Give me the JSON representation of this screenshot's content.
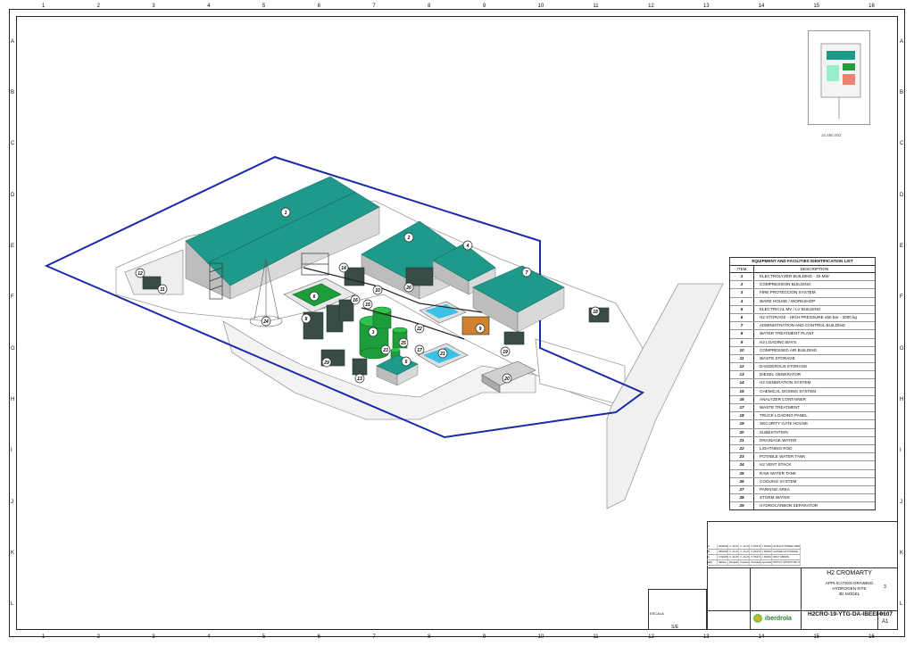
{
  "sheet": {
    "columns": [
      "1",
      "2",
      "3",
      "4",
      "5",
      "6",
      "7",
      "8",
      "9",
      "10",
      "11",
      "12",
      "13",
      "14",
      "15",
      "16"
    ],
    "rows": [
      "A",
      "B",
      "C",
      "D",
      "E",
      "F",
      "G",
      "H",
      "I",
      "J",
      "K",
      "L"
    ]
  },
  "key_plan": {
    "label": "15.480.002"
  },
  "equipment_list": {
    "title": "EQUIPMENT AND FACILITIES IDENTIFICATION LIST",
    "col_item": "ITEM",
    "col_desc": "DESCRIPTION",
    "items": [
      {
        "n": "1",
        "d": "ELECTROLYZER BUILDING - 15 MW"
      },
      {
        "n": "2",
        "d": "COMPRESSION BUILDING"
      },
      {
        "n": "3",
        "d": "FIRE PROTECCION SYSTEM"
      },
      {
        "n": "4",
        "d": "WARE HOUSE / WORKSHOP"
      },
      {
        "n": "5",
        "d": "ELECTRICAL MV / LV BUILDING"
      },
      {
        "n": "6",
        "d": "H2 STORAGE - HIGH PRESSURE 450 bar - 2000 kg"
      },
      {
        "n": "7",
        "d": "ADMINISTRATION AND CONTROL BUILDING"
      },
      {
        "n": "8",
        "d": "WATER TREATMENT PLANT"
      },
      {
        "n": "9",
        "d": "H2 LOADING BAYS"
      },
      {
        "n": "10",
        "d": "COMPRESSED AIR BUILDING"
      },
      {
        "n": "11",
        "d": "WASTE STORAGE"
      },
      {
        "n": "12",
        "d": "DANGEROUS STORAGE"
      },
      {
        "n": "13",
        "d": "DIESEL GENERATOR"
      },
      {
        "n": "14",
        "d": "H2 GENERATION SYSTEM"
      },
      {
        "n": "15",
        "d": "CHEMICAL DOSING SYSTEM"
      },
      {
        "n": "16",
        "d": "ANALYZER CONTAINER"
      },
      {
        "n": "17",
        "d": "WASTE TREATMENT"
      },
      {
        "n": "18",
        "d": "TRUCK LOADING PANEL"
      },
      {
        "n": "19",
        "d": "SECURITY GATE HOUSE"
      },
      {
        "n": "20",
        "d": "SUBESTATION"
      },
      {
        "n": "21",
        "d": "DRAINAGE WATER"
      },
      {
        "n": "22",
        "d": "LIGHTNING ROD"
      },
      {
        "n": "23",
        "d": "POTABLE WATER TANK"
      },
      {
        "n": "24",
        "d": "H2 VENT STACK"
      },
      {
        "n": "25",
        "d": "RAW WATER TANK"
      },
      {
        "n": "26",
        "d": "COOLING SYSTEM"
      },
      {
        "n": "27",
        "d": "PARKING AREA"
      },
      {
        "n": "28",
        "d": "STORM WATER"
      },
      {
        "n": "29",
        "d": "HYDROCARBON SEPARATOR"
      }
    ]
  },
  "site_labels": [
    "1",
    "2",
    "4",
    "7",
    "8",
    "9",
    "12",
    "11",
    "14",
    "15",
    "16",
    "6",
    "3",
    "25",
    "23",
    "5",
    "17",
    "21",
    "22",
    "20",
    "26",
    "13",
    "10",
    "19",
    "24",
    "29",
    "18"
  ],
  "title_block": {
    "project": "H2 CROMARTY",
    "lines": [
      "APPLICATION DRAWING",
      "HYDROGEN SITE",
      "3D MODEL"
    ],
    "doc_number": "H2CRO-19-YTG-DA-IBEEI-0107",
    "scale_label": "ESCALA",
    "scale": "S/E",
    "company": "iberdrola",
    "rev_label": "Rev",
    "rev": "A1",
    "sheet_no": "3"
  },
  "revisions": [
    [
      "C",
      "29/06/2022",
      "C. ALONSO",
      "C. ALONSO",
      "P. PASTOR",
      "J. BORGES",
      "H2 PLANT POWER 15MW"
    ],
    [
      "B",
      "28/03/2022",
      "C. ALONSO",
      "C. ALONSO",
      "P. PASTOR",
      "J. BORGES",
      "CHANGE H2 STORAGE"
    ],
    [
      "A",
      "17/03/2022",
      "C. ALONSO",
      "C. ALONSO",
      "P. PASTOR",
      "J. BORGES",
      "FIRST UPDATE"
    ],
    [
      "REV",
      "FECHA",
      "Dibujado",
      "Preparado",
      "Revisado",
      "Aprobado",
      "MOTIVO / ESTADO DE LA REVISION"
    ]
  ],
  "colors": {
    "boundary": "#1a2aa8",
    "roof": "#1f9a8a",
    "wall": "#d6d6d6",
    "equipment_green": "#1e9e3a",
    "pool": "#3cc0e6"
  }
}
